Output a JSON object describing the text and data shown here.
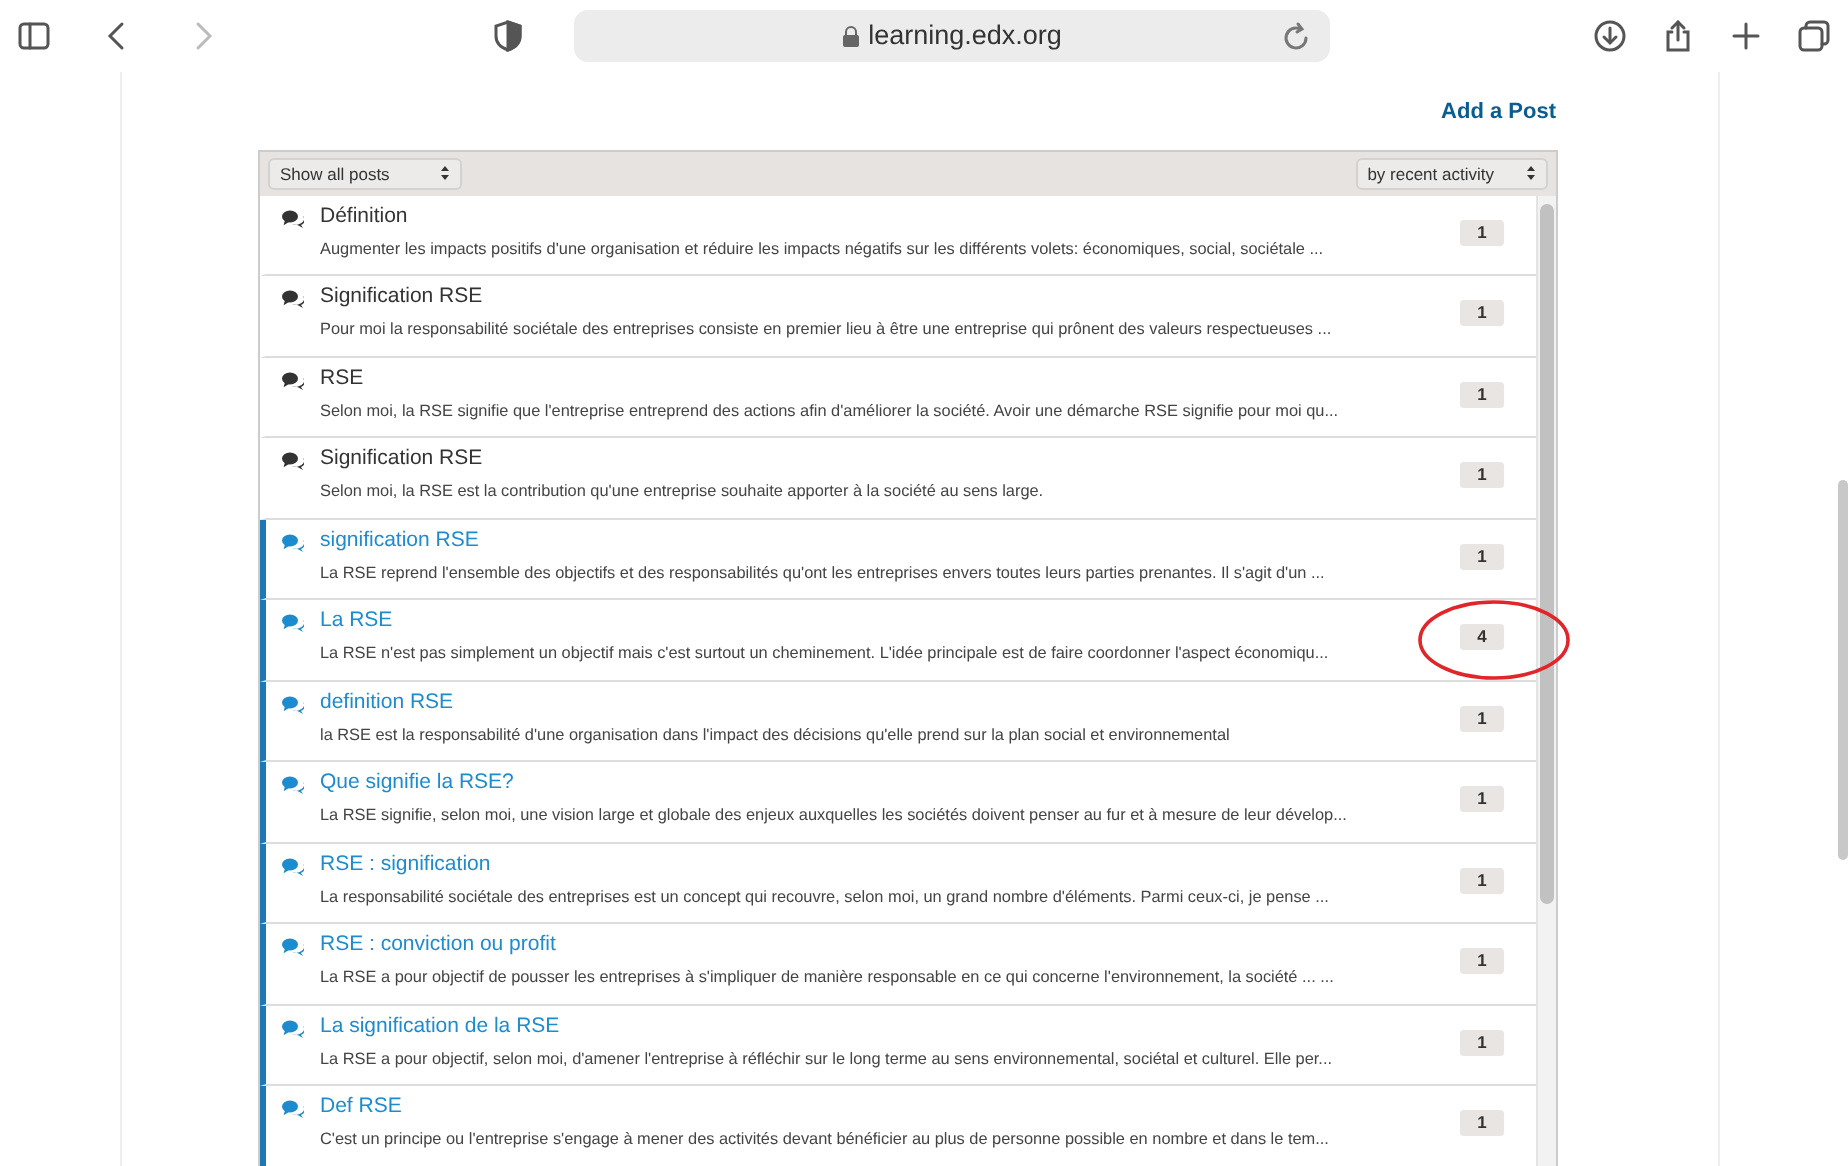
{
  "browser": {
    "url": "learning.edx.org"
  },
  "add_post": "Add a Post",
  "filters": {
    "show": "Show all posts",
    "sort": "by recent activity"
  },
  "posts": [
    {
      "title": "Définition",
      "excerpt": "Augmenter les impacts positifs d'une organisation et réduire les impacts négatifs sur les différents volets: économiques, social, sociétale ...",
      "count": "1",
      "unread": false,
      "highlighted": false
    },
    {
      "title": "Signification RSE",
      "excerpt": "Pour moi la responsabilité sociétale des entreprises consiste en premier lieu à être une entreprise qui prônent des valeurs respectueuses ...",
      "count": "1",
      "unread": false,
      "highlighted": false
    },
    {
      "title": "RSE",
      "excerpt": "Selon moi, la RSE signifie que l'entreprise entreprend des actions afin d'améliorer la société. Avoir une démarche RSE signifie pour moi qu...",
      "count": "1",
      "unread": false,
      "highlighted": false
    },
    {
      "title": "Signification RSE",
      "excerpt": "Selon moi, la RSE est la contribution qu'une entreprise souhaite apporter à la société au sens large.",
      "count": "1",
      "unread": false,
      "highlighted": false
    },
    {
      "title": "signification RSE",
      "excerpt": "La RSE reprend l'ensemble des objectifs et des responsabilités qu'ont les entreprises envers toutes leurs parties prenantes. Il s'agit d'un ...",
      "count": "1",
      "unread": true,
      "highlighted": false
    },
    {
      "title": "La RSE",
      "excerpt": "La RSE n'est pas simplement un objectif mais c'est surtout un cheminement. L'idée principale est de faire coordonner l'aspect économiqu...",
      "count": "4",
      "unread": true,
      "highlighted": true
    },
    {
      "title": "definition RSE",
      "excerpt": "la RSE est la responsabilité d'une organisation dans l'impact des décisions qu'elle prend sur la plan social et environnemental",
      "count": "1",
      "unread": true,
      "highlighted": false
    },
    {
      "title": "Que signifie la RSE?",
      "excerpt": "La RSE signifie, selon moi, une vision large et globale des enjeux auxquelles les sociétés doivent penser au fur et à mesure de leur dévelop...",
      "count": "1",
      "unread": true,
      "highlighted": false
    },
    {
      "title": "RSE : signification",
      "excerpt": "La responsabilité sociétale des entreprises est un concept qui recouvre, selon moi, un grand nombre d'éléments. Parmi ceux-ci, je pense ...",
      "count": "1",
      "unread": true,
      "highlighted": false
    },
    {
      "title": "RSE : conviction ou profit",
      "excerpt": "La RSE a pour objectif de pousser les entreprises à s'impliquer de manière responsable en ce qui concerne l'environnement, la société ... ...",
      "count": "1",
      "unread": true,
      "highlighted": false
    },
    {
      "title": "La signification de la RSE",
      "excerpt": "La RSE a pour objectif, selon moi, d'amener l'entreprise à réfléchir sur le long terme au sens environnemental, sociétal et culturel. Elle per...",
      "count": "1",
      "unread": true,
      "highlighted": false
    },
    {
      "title": "Def RSE",
      "excerpt": "C'est un principe ou l'entreprise s'engage à mener des activités devant bénéficier au plus de personne possible en nombre et dans le tem...",
      "count": "1",
      "unread": true,
      "highlighted": false
    }
  ]
}
